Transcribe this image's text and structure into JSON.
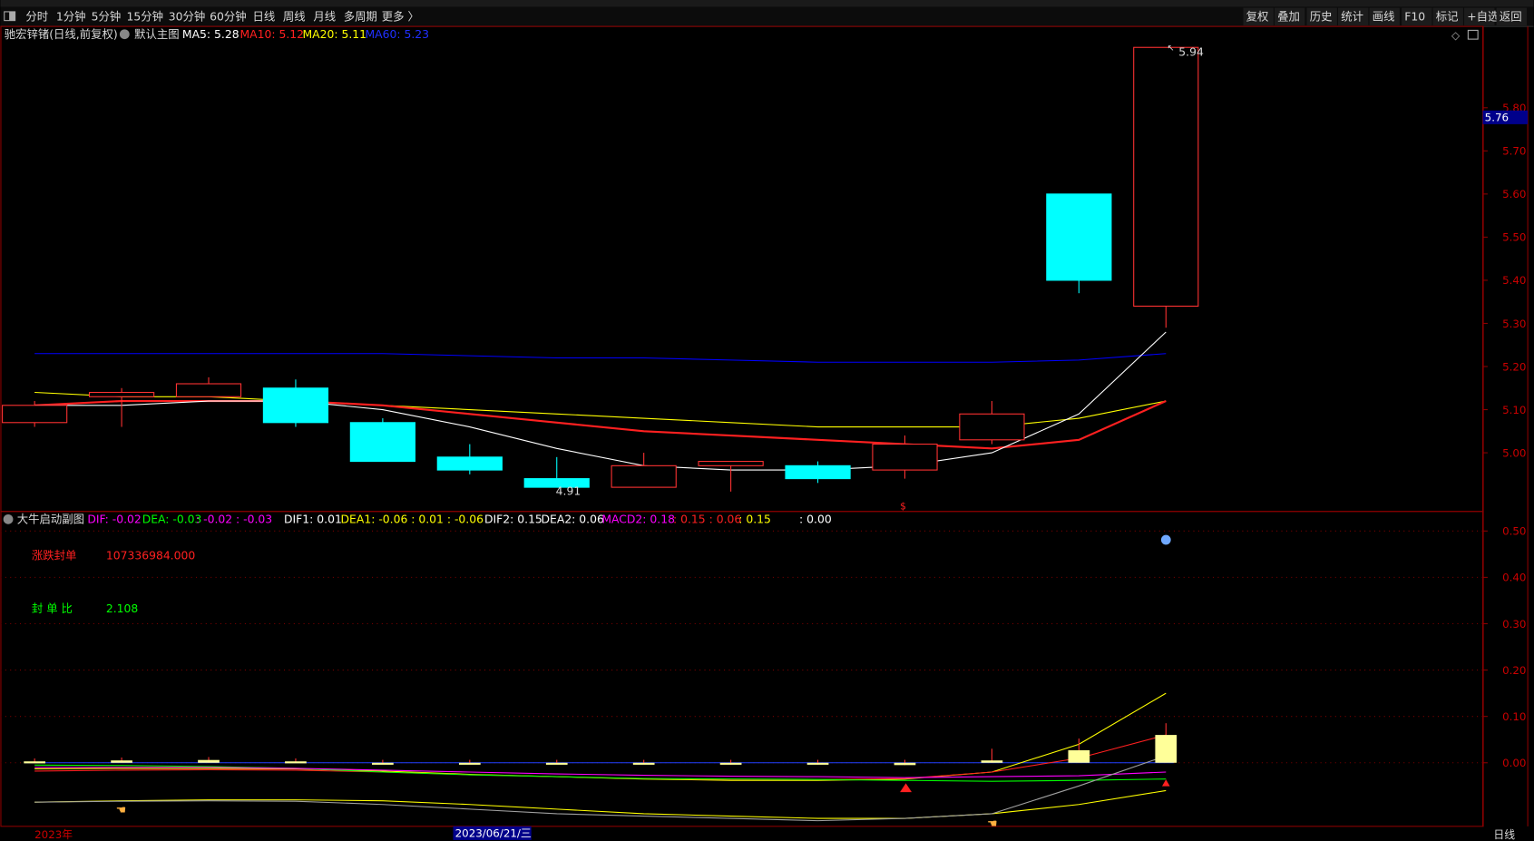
{
  "toolbar": {
    "periods": [
      "分时",
      "1分钟",
      "5分钟",
      "15分钟",
      "30分钟",
      "60分钟",
      "日线",
      "周线",
      "月线",
      "多周期",
      "更多 〉"
    ],
    "active_period": "日线",
    "actions": [
      "复权",
      "叠加",
      "历史",
      "统计",
      "画线",
      "F10",
      "标记",
      "+自选",
      "返回"
    ]
  },
  "main": {
    "stock_title": "驰宏锌锗(日线,前复权)",
    "template": "默认主图",
    "ma5": "MA5: 5.28",
    "ma10": "MA10: 5.12",
    "ma20": "MA20: 5.11",
    "ma60": "MA60: 5.23",
    "high_label": "5.94",
    "low_label": "4.91",
    "current_price": "5.76",
    "y_ticks": [
      "5.80",
      "5.70",
      "5.60",
      "5.50",
      "5.40",
      "5.30",
      "5.20",
      "5.10",
      "5.00"
    ]
  },
  "sub": {
    "title": "大牛启动副图",
    "dif": "DIF: -0.02",
    "dea": "DEA: -0.03",
    "dea_extra": ": -0.02 : -0.03",
    "dif1": "DIF1: 0.01",
    "dea1": "DEA1: -0.06 : 0.01 : -0.06",
    "dif2": "DIF2: 0.15",
    "dea2": "DEA2: 0.06",
    "macd2": "MACD2: 0.18",
    "macd2_red": ": 0.15 : 0.06",
    "macd2_yellow": ": 0.15",
    "tail": ": 0.00",
    "seal_label": "涨跌封单",
    "seal_value": "107336984.000",
    "ratio_label": "封 单 比",
    "ratio_value": "2.108",
    "y_ticks": [
      "0.50",
      "0.40",
      "0.30",
      "0.20",
      "0.10",
      "0.00"
    ]
  },
  "footer": {
    "year": "2023年",
    "cursor_date": "2023/06/21/三",
    "period_label": "日线"
  },
  "colors": {
    "up": "#ff3232",
    "down": "#00ffff",
    "ma5": "#ffffff",
    "ma10": "#ff2020",
    "ma20": "#ffff00",
    "ma60": "#0000ff",
    "axis": "#8b0000"
  },
  "chart_data": {
    "type": "candlestick",
    "candles": [
      {
        "o": 5.07,
        "h": 5.12,
        "l": 5.06,
        "c": 5.11
      },
      {
        "o": 5.13,
        "h": 5.15,
        "l": 5.06,
        "c": 5.14
      },
      {
        "o": 5.13,
        "h": 5.175,
        "l": 5.13,
        "c": 5.16
      },
      {
        "o": 5.15,
        "h": 5.17,
        "l": 5.06,
        "c": 5.07
      },
      {
        "o": 5.07,
        "h": 5.08,
        "l": 4.98,
        "c": 4.98
      },
      {
        "o": 4.99,
        "h": 5.02,
        "l": 4.95,
        "c": 4.96
      },
      {
        "o": 4.94,
        "h": 4.99,
        "l": 4.92,
        "c": 4.92
      },
      {
        "o": 4.92,
        "h": 5.0,
        "l": 4.92,
        "c": 4.97
      },
      {
        "o": 4.97,
        "h": 4.98,
        "l": 4.91,
        "c": 4.98
      },
      {
        "o": 4.97,
        "h": 4.98,
        "l": 4.93,
        "c": 4.94
      },
      {
        "o": 4.96,
        "h": 5.04,
        "l": 4.94,
        "c": 5.02
      },
      {
        "o": 5.03,
        "h": 5.12,
        "l": 5.02,
        "c": 5.09
      },
      {
        "o": 5.6,
        "h": 5.6,
        "l": 5.37,
        "c": 5.4
      },
      {
        "o": 5.34,
        "h": 5.94,
        "l": 5.29,
        "c": 5.94
      }
    ],
    "ma5": [
      5.11,
      5.11,
      5.12,
      5.12,
      5.1,
      5.06,
      5.01,
      4.97,
      4.96,
      4.96,
      4.97,
      5.0,
      5.09,
      5.28
    ],
    "ma10": [
      5.11,
      5.12,
      5.12,
      5.12,
      5.11,
      5.09,
      5.07,
      5.05,
      5.04,
      5.03,
      5.02,
      5.01,
      5.03,
      5.12
    ],
    "ma20": [
      5.14,
      5.13,
      5.13,
      5.12,
      5.11,
      5.1,
      5.09,
      5.08,
      5.07,
      5.06,
      5.06,
      5.06,
      5.08,
      5.12
    ],
    "ma60": [
      5.23,
      5.23,
      5.23,
      5.23,
      5.23,
      5.225,
      5.22,
      5.22,
      5.215,
      5.21,
      5.21,
      5.21,
      5.215,
      5.23
    ],
    "sub_bars": [
      0.003,
      0.005,
      0.006,
      0.003,
      -0.002,
      -0.003,
      -0.003,
      -0.001,
      -0.004,
      -0.004,
      -0.005,
      0.005,
      0.027,
      0.06
    ],
    "sub_lines": [
      {
        "color": "#ffff00",
        "values": [
          -0.013,
          -0.012,
          -0.012,
          -0.013,
          -0.018,
          -0.025,
          -0.03,
          -0.035,
          -0.038,
          -0.038,
          -0.035,
          -0.02,
          0.04,
          0.15
        ]
      },
      {
        "color": "#ff2020",
        "values": [
          -0.018,
          -0.016,
          -0.015,
          -0.016,
          -0.02,
          -0.026,
          -0.03,
          -0.034,
          -0.036,
          -0.036,
          -0.034,
          -0.02,
          0.01,
          0.06
        ]
      },
      {
        "color": "#00ff00",
        "values": [
          -0.005,
          -0.006,
          -0.008,
          -0.012,
          -0.02,
          -0.026,
          -0.03,
          -0.034,
          -0.035,
          -0.036,
          -0.038,
          -0.04,
          -0.038,
          -0.035
        ]
      },
      {
        "color": "#ff00ff",
        "values": [
          -0.01,
          -0.01,
          -0.01,
          -0.012,
          -0.016,
          -0.02,
          -0.024,
          -0.027,
          -0.029,
          -0.03,
          -0.032,
          -0.03,
          -0.028,
          -0.02
        ]
      },
      {
        "color": "#ffff00",
        "values": [
          -0.085,
          -0.082,
          -0.08,
          -0.08,
          -0.082,
          -0.09,
          -0.1,
          -0.11,
          -0.115,
          -0.12,
          -0.12,
          -0.11,
          -0.09,
          -0.06
        ]
      },
      {
        "color": "#a0a0a0",
        "values": [
          -0.085,
          -0.083,
          -0.082,
          -0.083,
          -0.09,
          -0.1,
          -0.11,
          -0.115,
          -0.12,
          -0.125,
          -0.12,
          -0.11,
          -0.05,
          0.015
        ]
      }
    ]
  }
}
